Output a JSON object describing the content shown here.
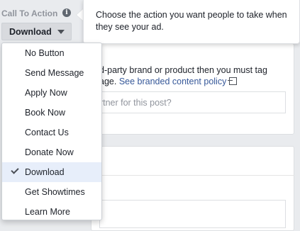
{
  "cta": {
    "label": "Call To Action",
    "info_glyph": "i",
    "selected": "Download"
  },
  "tooltip": {
    "text": "Choose the action you want people to take when they see your ad."
  },
  "background": {
    "branded_text": "d-party brand or product then you must tag",
    "branded_text_2": "age.",
    "policy_link": "See branded content policy",
    "partner_placeholder": "artner for this post?"
  },
  "menu": {
    "items": [
      {
        "label": "No Button",
        "selected": false
      },
      {
        "label": "Send Message",
        "selected": false
      },
      {
        "label": "Apply Now",
        "selected": false
      },
      {
        "label": "Book Now",
        "selected": false
      },
      {
        "label": "Contact Us",
        "selected": false
      },
      {
        "label": "Donate Now",
        "selected": false
      },
      {
        "label": "Download",
        "selected": true
      },
      {
        "label": "Get Showtimes",
        "selected": false
      },
      {
        "label": "Learn More",
        "selected": false
      }
    ]
  },
  "colors": {
    "link": "#365899",
    "selected_row": "#e7eefa",
    "page_bg": "#e9ebee"
  }
}
